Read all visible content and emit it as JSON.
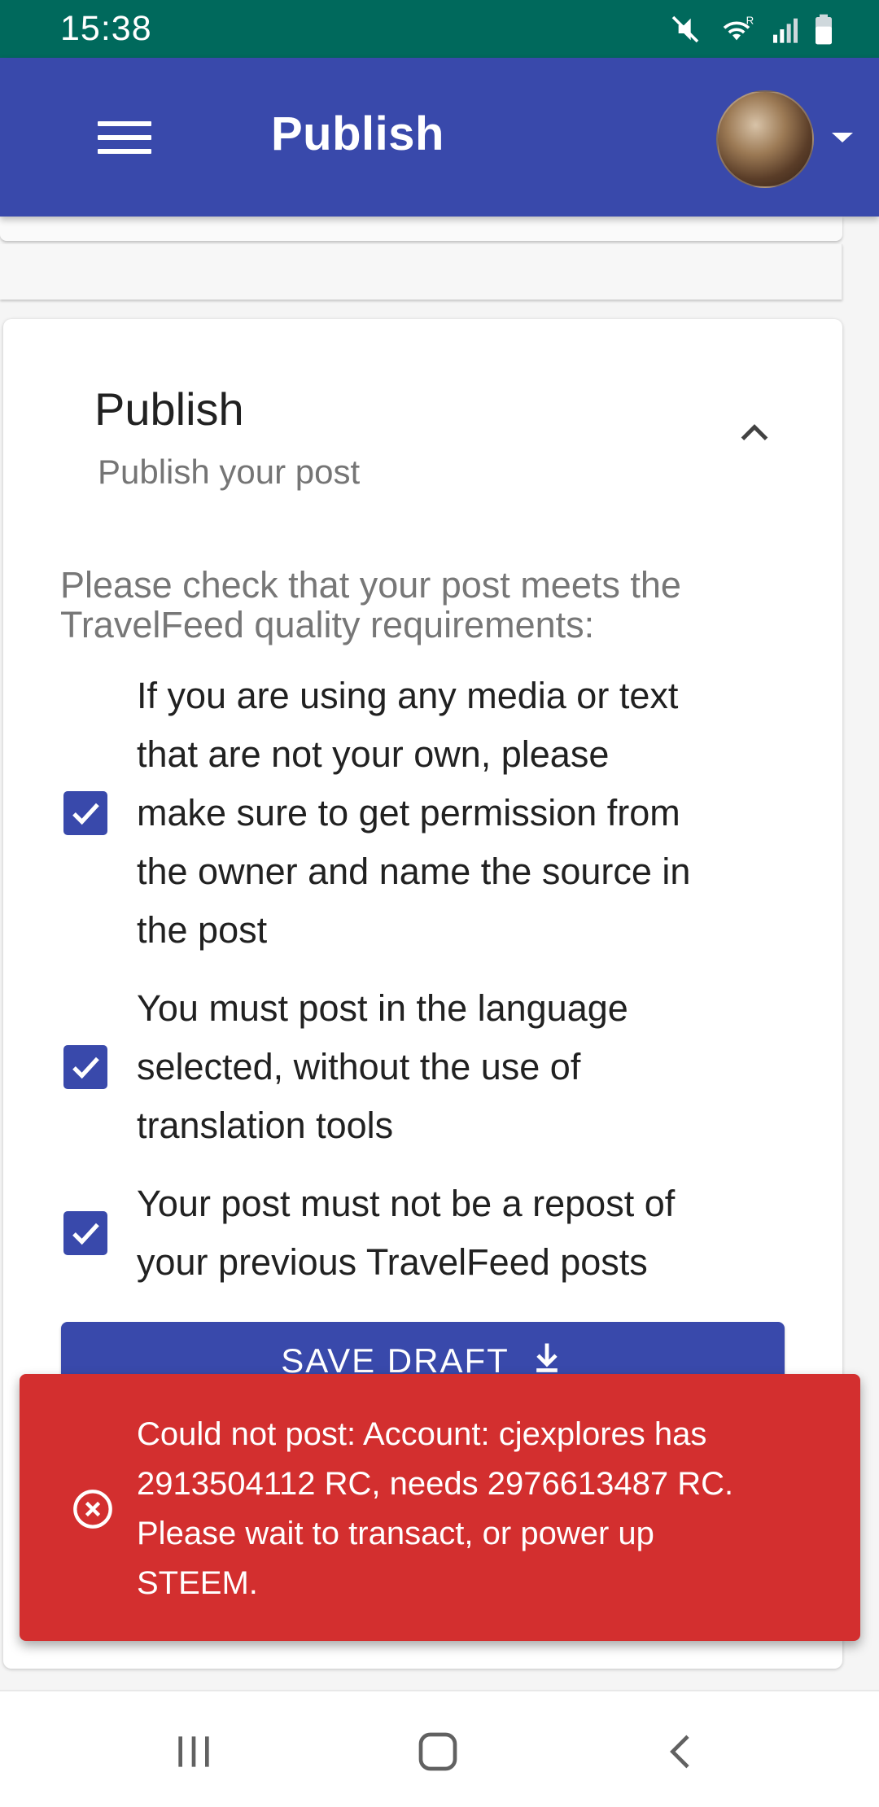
{
  "status_bar": {
    "time": "15:38",
    "icons": [
      "mute-icon",
      "wifi-icon",
      "signal-icon",
      "battery-icon"
    ]
  },
  "app_bar": {
    "title": "Publish",
    "menu_icon": "hamburger-menu-icon",
    "avatar_dropdown_icon": "caret-down-icon"
  },
  "publish_section": {
    "title": "Publish",
    "subtitle": "Publish your post",
    "collapse_icon": "chevron-up-icon",
    "intro_line1": "Please check that your post meets the",
    "intro_line2": "TravelFeed quality requirements:",
    "checks": [
      {
        "checked": true,
        "lines": [
          "If you are using any media or text",
          "that are not your own, please",
          "make sure to get permission from",
          "the owner and name the source in",
          "the post"
        ]
      },
      {
        "checked": true,
        "lines": [
          "You must post in the language",
          "selected, without the use of",
          "translation tools"
        ]
      },
      {
        "checked": true,
        "lines": [
          "Your post must not be a repost of",
          "your previous TravelFeed posts"
        ]
      }
    ],
    "save_draft_label": "SAVE DRAFT"
  },
  "error_snackbar": {
    "icon": "error-circle-x-icon",
    "lines": [
      "Could not post: Account: cjexplores has",
      "2913504112 RC, needs 2976613487 RC.",
      "Please wait to transact, or power up",
      "STEEM."
    ]
  },
  "nav_bar": {
    "buttons": [
      "recents-icon",
      "home-icon",
      "back-icon"
    ]
  },
  "colors": {
    "status_bar": "#00695c",
    "app_bar": "#3949ab",
    "checkbox": "#3949ab",
    "error": "#d32f2f"
  }
}
